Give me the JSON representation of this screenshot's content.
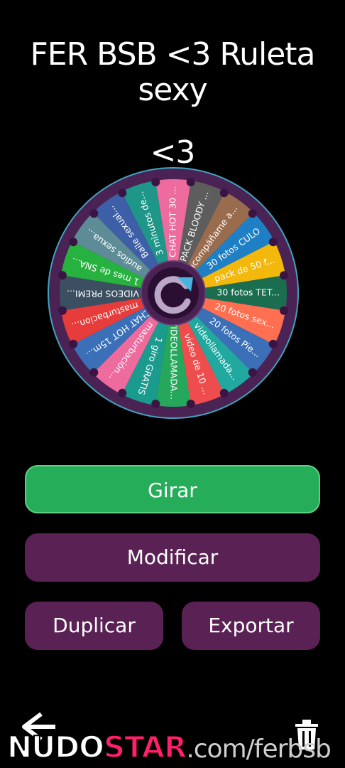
{
  "header": {
    "title_line1": "FER BSB <3 Ruleta sexy",
    "title_line2": "<3"
  },
  "wheel": {
    "segments": [
      {
        "label": "CHAT HOT 30 ...",
        "color": "#ee6b9e"
      },
      {
        "label": "PACK BLOODY ...",
        "color": "#5d5d5d"
      },
      {
        "label": "acompáñame a...",
        "color": "#9a6c4e"
      },
      {
        "label": "30 fotos CULO",
        "color": "#1e7fc4"
      },
      {
        "label": "pack de 50 f...",
        "color": "#f2b80b"
      },
      {
        "label": "30 fotos TET...",
        "color": "#1a6e4f"
      },
      {
        "label": "20 fotos sex...",
        "color": "#ff6f50"
      },
      {
        "label": "20 fotos Pie...",
        "color": "#3b6fb8"
      },
      {
        "label": "videollamada...",
        "color": "#21a9a0"
      },
      {
        "label": "video de 10 ...",
        "color": "#ef4d4d"
      },
      {
        "label": "VIDEOLLAMADA...",
        "color": "#26a85c"
      },
      {
        "label": "1 giro GRATIS",
        "color": "#1b9a8e"
      },
      {
        "label": "masturbación...",
        "color": "#ee6b9e"
      },
      {
        "label": "CHAT HOT 15m...",
        "color": "#3b6fb8"
      },
      {
        "label": "masturbacion...",
        "color": "#e63c3c"
      },
      {
        "label": "VIDEOS PREMI...",
        "color": "#3b4f61"
      },
      {
        "label": "1 mes de SNA...",
        "color": "#27b13f"
      },
      {
        "label": "audios sexua...",
        "color": "#5e8c96"
      },
      {
        "label": "Baile sexual...",
        "color": "#3d5fa8"
      },
      {
        "label": "3 minutos de...",
        "color": "#1e9688"
      }
    ],
    "center_icon": "refresh-icon",
    "rim_color": "#4a2253",
    "pin_color": "#3a1442"
  },
  "buttons": {
    "spin": "Girar",
    "modify": "Modificar",
    "duplicate": "Duplicar",
    "export": "Exportar"
  },
  "footer": {
    "back_icon": "back-arrow-icon",
    "delete_icon": "trash-icon",
    "watermark_nudo": "NUDO",
    "watermark_star": "STAR",
    "watermark_url": ".com/ferbsb"
  }
}
